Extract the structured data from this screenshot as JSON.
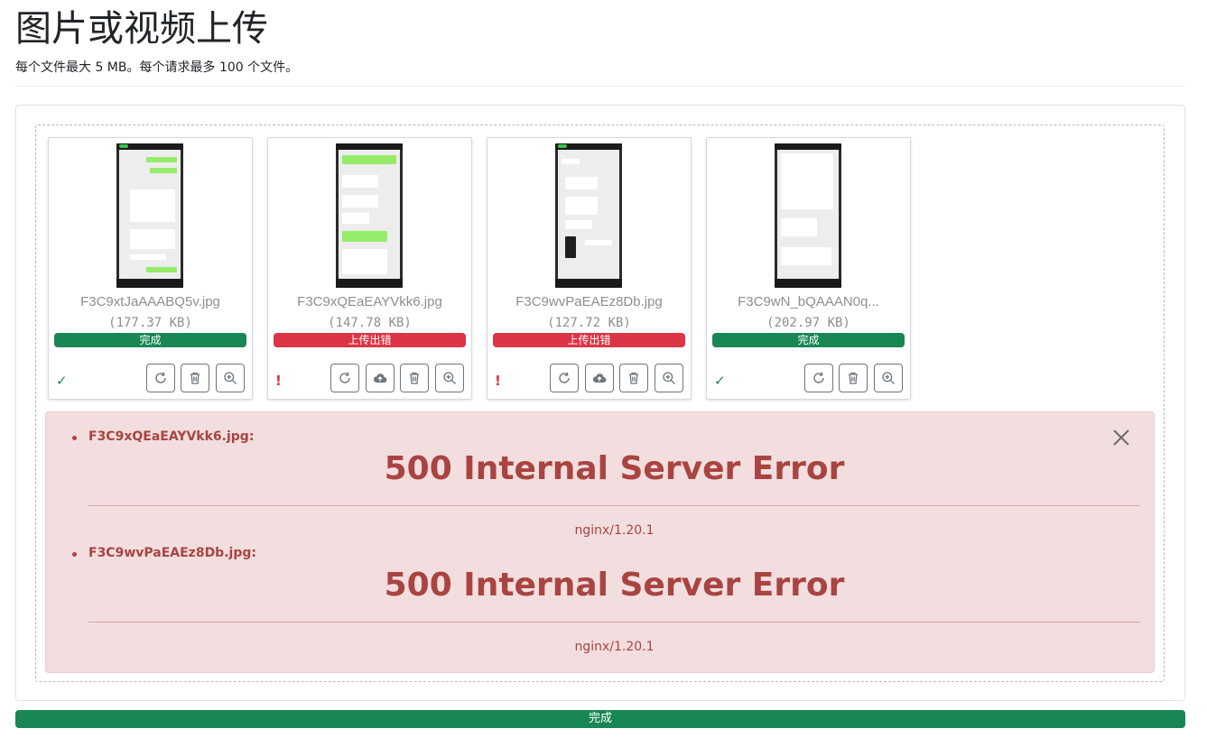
{
  "header": {
    "title": "图片或视频上传",
    "subtitle": "每个文件最大 5 MB。每个请求最多 100 个文件。"
  },
  "colors": {
    "success": "#198754",
    "danger": "#dc3545",
    "alert_text": "#a94442",
    "alert_bg": "#f2dede"
  },
  "files": [
    {
      "name": "F3C9xtJaAAABQ5v.jpg",
      "size": "(177.37 KB)",
      "status": "完成",
      "state": "success",
      "mark": "✓"
    },
    {
      "name": "F3C9xQEaEAYVkk6.jpg",
      "size": "(147.78 KB)",
      "status": "上传出错",
      "state": "error",
      "mark": "!"
    },
    {
      "name": "F3C9wvPaEAEz8Db.jpg",
      "size": "(127.72 KB)",
      "status": "上传出错",
      "state": "error",
      "mark": "!"
    },
    {
      "name": "F3C9wN_bQAAAN0q...",
      "size": "(202.97 KB)",
      "status": "完成",
      "state": "success",
      "mark": "✓"
    }
  ],
  "icons": {
    "retry": "rotate-icon",
    "upload": "cloud-upload-icon",
    "delete": "trash-icon",
    "zoom": "zoom-in-icon",
    "close": "close-icon"
  },
  "errors": [
    {
      "file": "F3C9xQEaEAYVkk6.jpg:",
      "title": "500 Internal Server Error",
      "server": "nginx/1.20.1"
    },
    {
      "file": "F3C9wvPaEAEz8Db.jpg:",
      "title": "500 Internal Server Error",
      "server": "nginx/1.20.1"
    }
  ],
  "overall": {
    "label": "完成",
    "progress_percent": 100
  }
}
